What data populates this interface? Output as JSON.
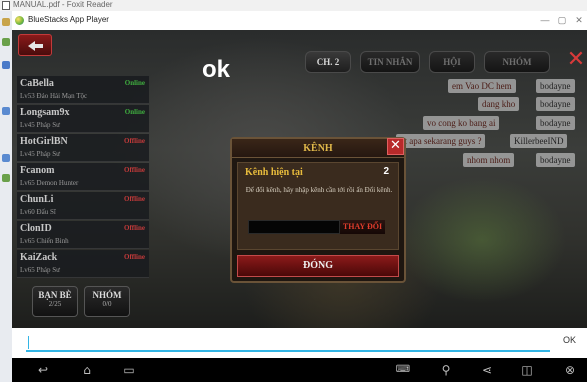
{
  "background_app": {
    "title": "MANUAL.pdf - Foxit Reader"
  },
  "window": {
    "title": "BlueStacks App Player",
    "controls": [
      "—",
      "▢",
      "✕"
    ]
  },
  "game": {
    "overlay_text": "ok",
    "tabs": [
      "CH. 2",
      "TIN NHẮN",
      "HỘI",
      "NHÓM"
    ],
    "friends": [
      {
        "name": "CaBella",
        "subtitle": "Lv53 Đảo Hải Mạn Tộc",
        "status": "Online",
        "status_color": "#3fae3f"
      },
      {
        "name": "Longsam9x",
        "subtitle": "Lv45 Pháp Sư",
        "status": "Online",
        "status_color": "#3fae3f"
      },
      {
        "name": "HotGirlBN",
        "subtitle": "Lv45 Pháp Sư",
        "status": "Offline",
        "status_color": "#c43a3a"
      },
      {
        "name": "Fcanom",
        "subtitle": "Lv65 Demon Hunter",
        "status": "Offline",
        "status_color": "#c43a3a"
      },
      {
        "name": "ChunLi",
        "subtitle": "Lv60 Đấu Sĩ",
        "status": "Offline",
        "status_color": "#c43a3a"
      },
      {
        "name": "ClonID",
        "subtitle": "Lv65 Chiến Binh",
        "status": "Offline",
        "status_color": "#c43a3a"
      },
      {
        "name": "KaiZack",
        "subtitle": "Lv65 Pháp Sư",
        "status": "Offline",
        "status_color": "#c43a3a"
      }
    ],
    "list_buttons": [
      {
        "label": "BẠN BÈ",
        "count": "2/25"
      },
      {
        "label": "NHÓM",
        "count": "0/0"
      }
    ],
    "messages": [
      {
        "text": "em Vao DC hem",
        "user": "bodayne"
      },
      {
        "text": "dang kho",
        "user": "bodayne"
      },
      {
        "text": "vo cong ko bang ai",
        "user": "bodayne"
      },
      {
        "text": "pt apa sekarang guys ?",
        "user": "KillerbeeIND"
      },
      {
        "text": "nhom nhom",
        "user": "bodayne"
      }
    ],
    "dialog": {
      "title": "KÊNH",
      "current_label": "Kênh hiện tại",
      "current_value": "2",
      "description": "Để đổi kênh, hãy nhập kênh cần tới rồi ấn Đổi kênh.",
      "input_value": "",
      "change_button": "THAY ĐỔI",
      "close_button": "ĐÓNG"
    }
  },
  "input_bar": {
    "value": "",
    "ok_label": "OK"
  },
  "navbar": {
    "icons": [
      "back-icon",
      "home-icon",
      "recent-apps-icon",
      "keyboard-icon",
      "location-icon",
      "share-icon",
      "window-icon",
      "close-icon"
    ]
  }
}
